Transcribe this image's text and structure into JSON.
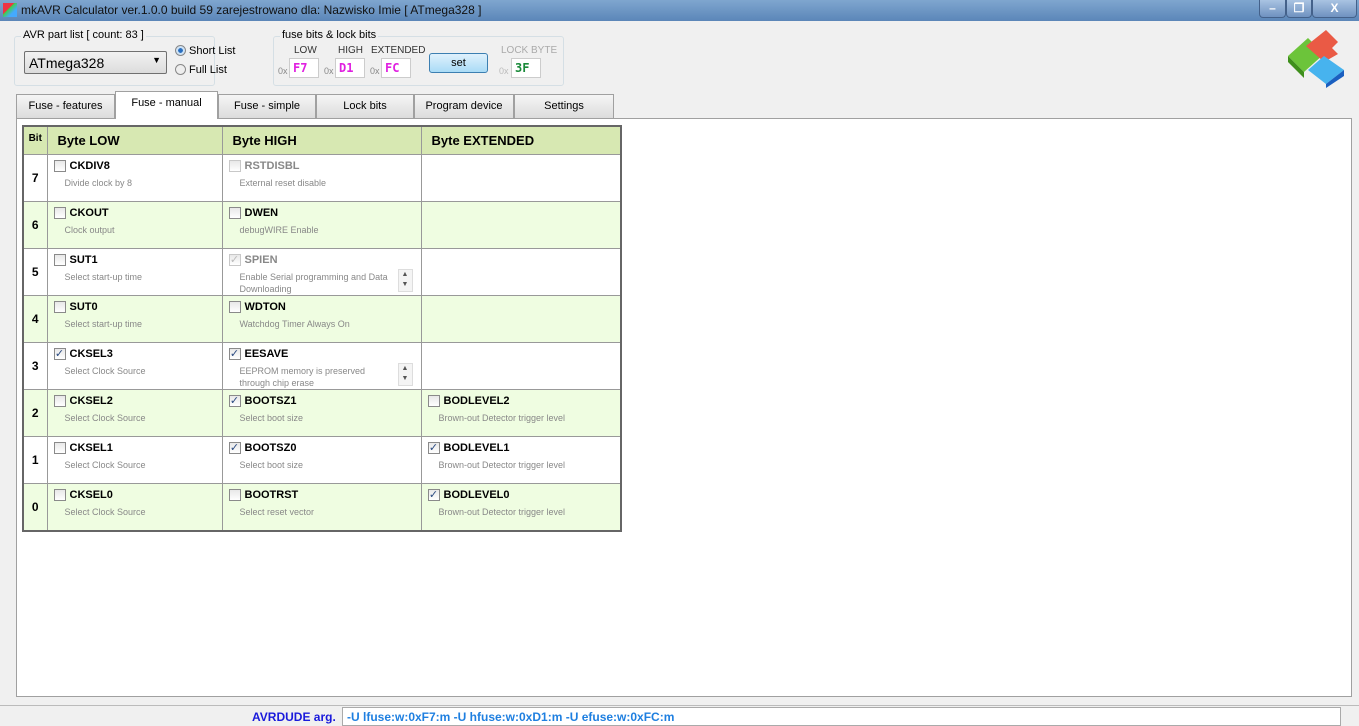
{
  "window": {
    "title": "mkAVR Calculator ver.1.0.0 build 59  zarejestrowano dla: Nazwisko Imie    [ ATmega328 ]",
    "minimize": "–",
    "restore": "❐",
    "close": "X"
  },
  "part_list": {
    "label": "AVR part list [ count: 83 ]",
    "selected": "ATmega328",
    "short_list": "Short List",
    "full_list": "Full List",
    "short_selected": true
  },
  "fuse_group": {
    "label": "fuse bits & lock bits",
    "prefix": "0x",
    "low_label": "LOW",
    "low": "F7",
    "high_label": "HIGH",
    "high": "D1",
    "ext_label": "EXTENDED",
    "ext": "FC",
    "set": "set",
    "lock_label": "LOCK BYTE",
    "lock": "3F"
  },
  "tabs": [
    "Fuse - features",
    "Fuse - manual",
    "Fuse - simple",
    "Lock bits",
    "Program device",
    "Settings"
  ],
  "active_tab": "Fuse - manual",
  "table": {
    "headers": {
      "bit": "Bit",
      "low": "Byte LOW",
      "high": "Byte HIGH",
      "ext": "Byte EXTENDED"
    },
    "rows": [
      {
        "bit": "7",
        "low": {
          "name": "CKDIV8",
          "desc": "Divide clock by 8",
          "checked": false
        },
        "high": {
          "name": "RSTDISBL",
          "desc": "External reset disable",
          "checked": false,
          "disabled": true
        },
        "ext": null
      },
      {
        "bit": "6",
        "low": {
          "name": "CKOUT",
          "desc": "Clock output",
          "checked": false
        },
        "high": {
          "name": "DWEN",
          "desc": "debugWIRE Enable",
          "checked": false
        },
        "ext": null
      },
      {
        "bit": "5",
        "low": {
          "name": "SUT1",
          "desc": "Select start-up time",
          "checked": false
        },
        "high": {
          "name": "SPIEN",
          "desc": "Enable Serial programming and Data Downloading",
          "checked": true,
          "disabled": true,
          "scroll": true
        },
        "ext": null
      },
      {
        "bit": "4",
        "low": {
          "name": "SUT0",
          "desc": "Select start-up time",
          "checked": false
        },
        "high": {
          "name": "WDTON",
          "desc": "Watchdog Timer Always On",
          "checked": false
        },
        "ext": null
      },
      {
        "bit": "3",
        "low": {
          "name": "CKSEL3",
          "desc": "Select Clock Source",
          "checked": true
        },
        "high": {
          "name": "EESAVE",
          "desc": "EEPROM memory is preserved through chip erase",
          "checked": true,
          "scroll": true
        },
        "ext": null
      },
      {
        "bit": "2",
        "low": {
          "name": "CKSEL2",
          "desc": "Select Clock Source",
          "checked": false
        },
        "high": {
          "name": "BOOTSZ1",
          "desc": "Select boot size",
          "checked": true
        },
        "ext": {
          "name": "BODLEVEL2",
          "desc": "Brown-out Detector trigger level",
          "checked": false
        }
      },
      {
        "bit": "1",
        "low": {
          "name": "CKSEL1",
          "desc": "Select Clock Source",
          "checked": false
        },
        "high": {
          "name": "BOOTSZ0",
          "desc": "Select boot size",
          "checked": true
        },
        "ext": {
          "name": "BODLEVEL1",
          "desc": "Brown-out Detector trigger level",
          "checked": true
        }
      },
      {
        "bit": "0",
        "low": {
          "name": "CKSEL0",
          "desc": "Select Clock Source",
          "checked": false
        },
        "high": {
          "name": "BOOTRST",
          "desc": "Select reset vector",
          "checked": false
        },
        "ext": {
          "name": "BODLEVEL0",
          "desc": "Brown-out Detector trigger level",
          "checked": true
        }
      }
    ]
  },
  "status": {
    "label": "AVRDUDE arg.",
    "value": "-U lfuse:w:0xF7:m  -U hfuse:w:0xD1:m  -U efuse:w:0xFC:m"
  }
}
